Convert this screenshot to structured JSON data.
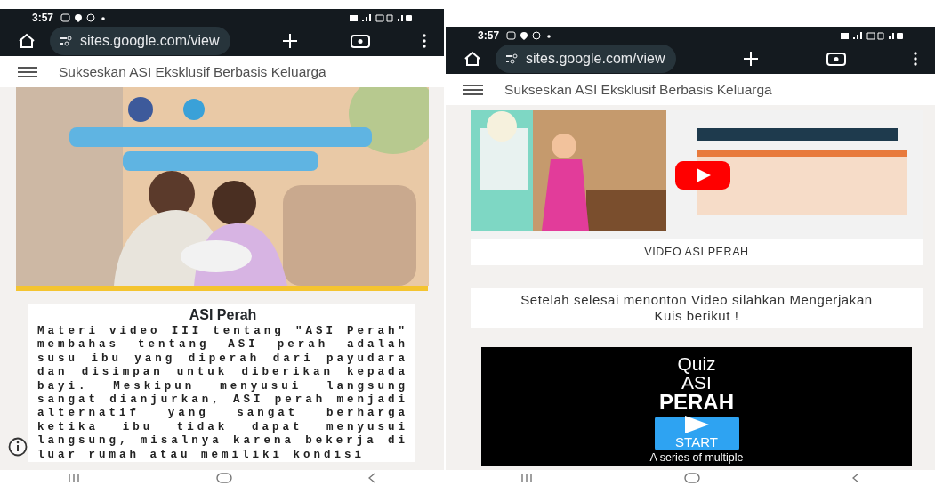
{
  "screens": [
    {
      "status_bar": {
        "time": "3:57"
      },
      "address_bar": {
        "url": "sites.google.com/view"
      },
      "site_header": {
        "title": "Sukseskan ASI Eksklusif Berbasis Keluarga"
      },
      "content": [
        {
          "kind": "hero"
        },
        {
          "kind": "text_card",
          "title": "ASI Perah",
          "body": "Materi video III tentang \"ASI Perah\" membahas tentang ASI perah adalah susu ibu yang diperah dari payudara dan disimpan untuk diberikan kepada bayi. Meskipun menyusui langsung sangat dianjurkan, ASI perah menjadi alternatif yang sangat berharga ketika ibu tidak dapat menyusui langsung, misalnya karena bekerja di luar rumah atau memiliki kondisi"
        }
      ]
    },
    {
      "status_bar": {
        "time": "3:57"
      },
      "address_bar": {
        "url": "sites.google.com/view"
      },
      "site_header": {
        "title": "Sukseskan ASI Eksklusif Berbasis Keluarga"
      },
      "content": [
        {
          "kind": "video_card",
          "caption": "VIDEO ASI PERAH"
        },
        {
          "kind": "note_card",
          "text": "Setelah selesai menonton Video silahkan Mengerjakan Kuis berikut !"
        },
        {
          "kind": "quiz_card",
          "lines": [
            "Quiz",
            "ASI",
            "PERAH"
          ],
          "button": "START",
          "subtitle": "A series of multiple"
        }
      ]
    }
  ]
}
